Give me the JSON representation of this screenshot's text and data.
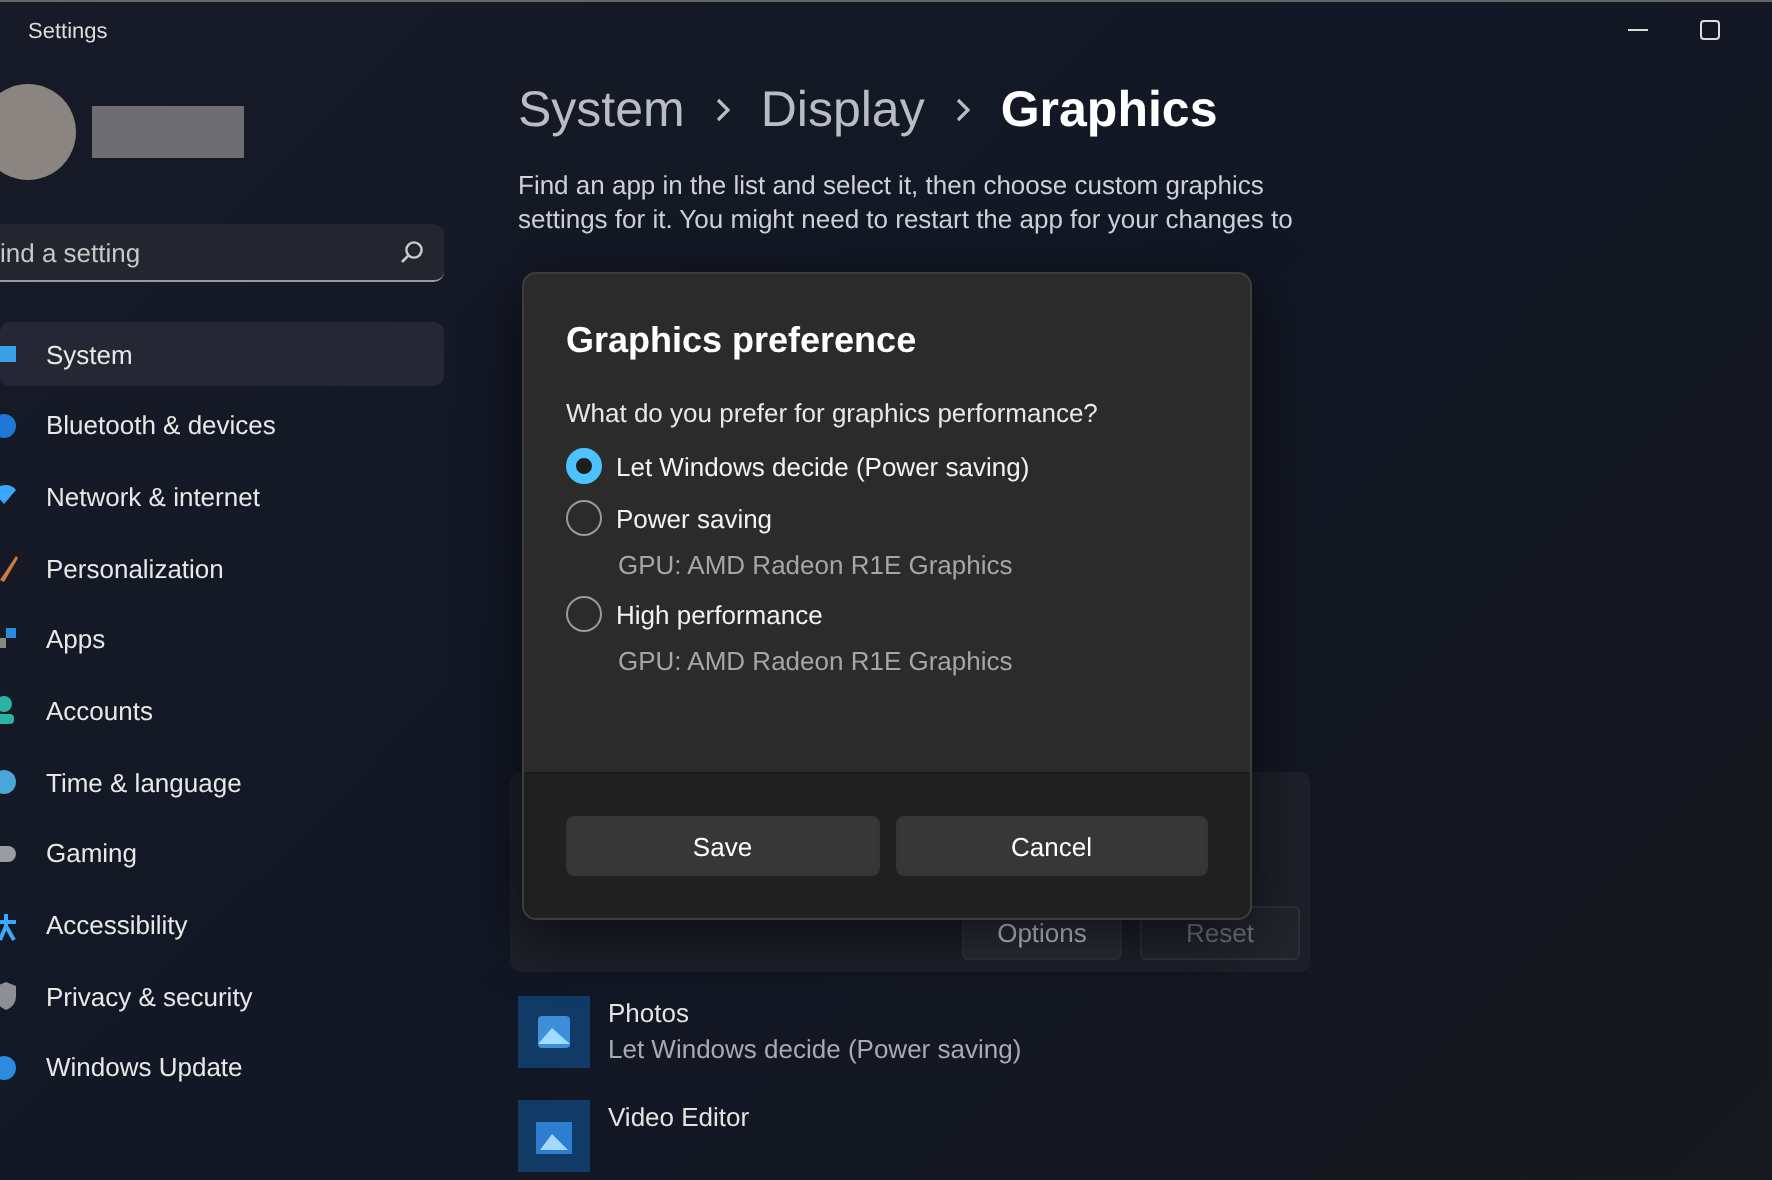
{
  "window": {
    "title": "Settings"
  },
  "search": {
    "placeholder": "ind a setting"
  },
  "nav": [
    {
      "label": "System",
      "selected": true
    },
    {
      "label": "Bluetooth & devices",
      "selected": false
    },
    {
      "label": "Network & internet",
      "selected": false
    },
    {
      "label": "Personalization",
      "selected": false
    },
    {
      "label": "Apps",
      "selected": false
    },
    {
      "label": "Accounts",
      "selected": false
    },
    {
      "label": "Time & language",
      "selected": false
    },
    {
      "label": "Gaming",
      "selected": false
    },
    {
      "label": "Accessibility",
      "selected": false
    },
    {
      "label": "Privacy & security",
      "selected": false
    },
    {
      "label": "Windows Update",
      "selected": false
    }
  ],
  "breadcrumb": [
    "System",
    "Display",
    "Graphics"
  ],
  "description": [
    "Find an app in the list and select it, then choose custom graphics",
    "settings for it. You might need to restart the app for your changes to"
  ],
  "app_card": {
    "buttons": [
      {
        "label": "Options",
        "disabled": false
      },
      {
        "label": "Reset",
        "disabled": true
      }
    ]
  },
  "apps": [
    {
      "name": "Photos",
      "preference": "Let Windows decide (Power saving)"
    },
    {
      "name": "Video Editor"
    }
  ],
  "dialog": {
    "title": "Graphics preference",
    "question": "What do you prefer for graphics performance?",
    "options": [
      {
        "label": "Let Windows decide (Power saving)",
        "selected": true
      },
      {
        "label": "Power saving",
        "detail": "GPU: AMD Radeon R1E Graphics",
        "selected": false
      },
      {
        "label": "High performance",
        "detail": "GPU: AMD Radeon R1E Graphics",
        "selected": false
      }
    ],
    "buttons": [
      "Save",
      "Cancel"
    ]
  }
}
